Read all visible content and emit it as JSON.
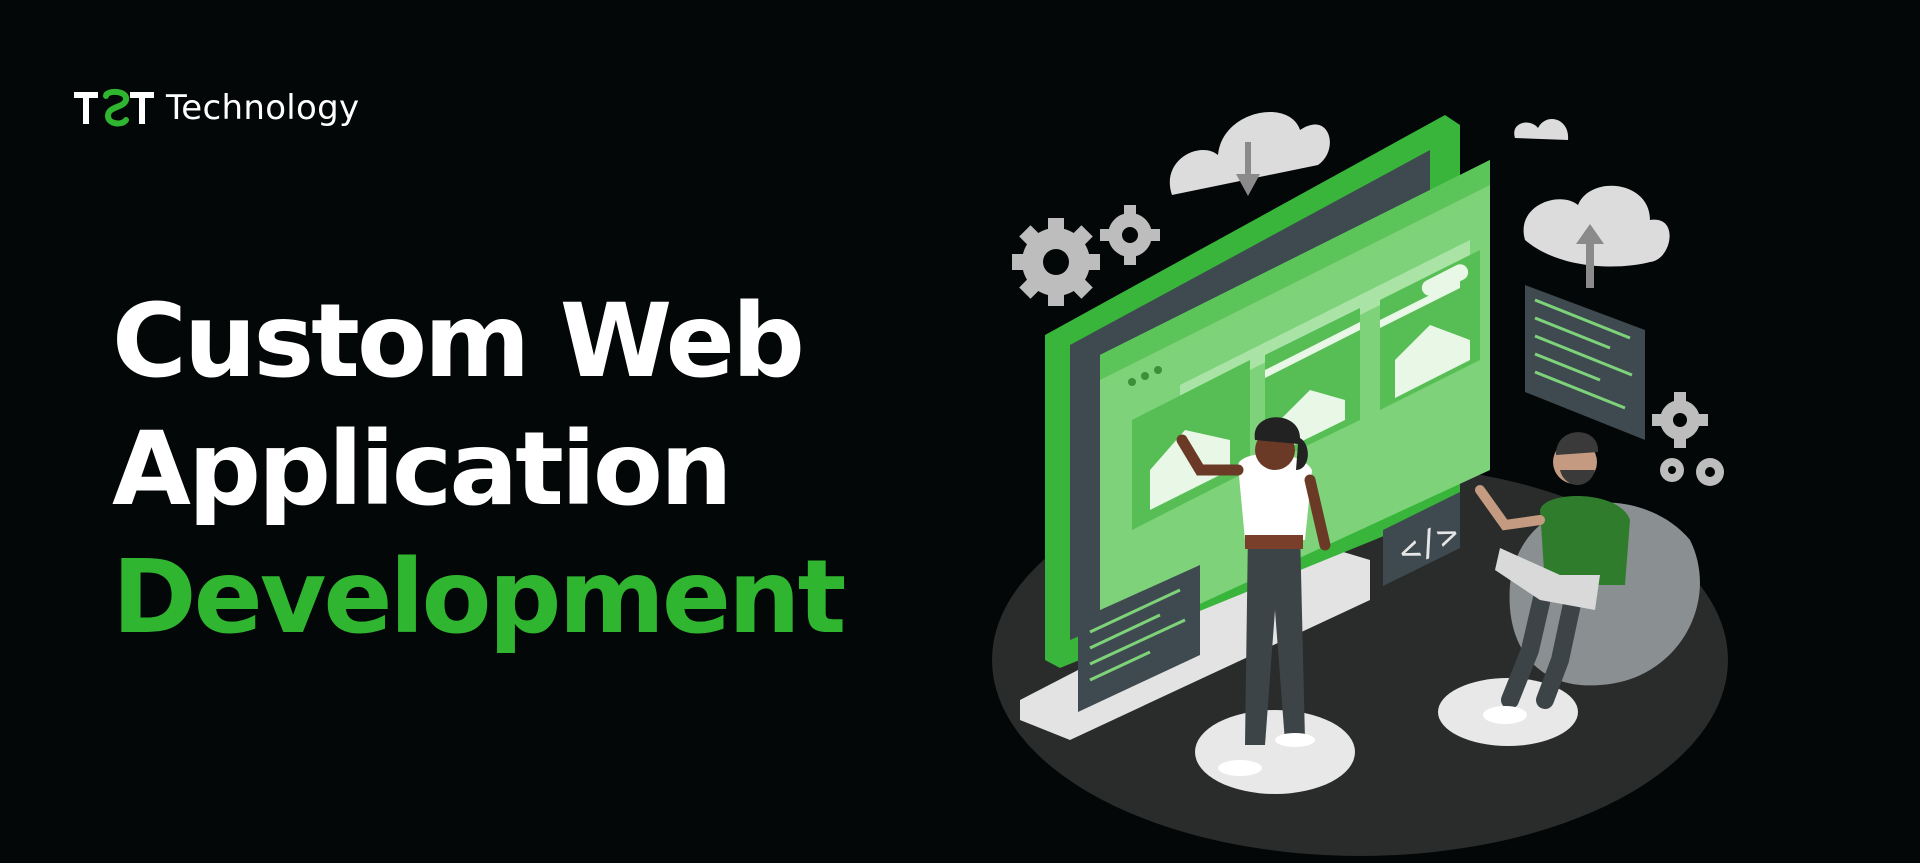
{
  "brand": {
    "logo_mark": "TST",
    "name": "Technology"
  },
  "headline": {
    "line1": "Custom Web",
    "line2": "Application",
    "line3": "Development"
  },
  "illustration": {
    "code_badge": "</>"
  },
  "colors": {
    "background": "#040707",
    "accent_green": "#2fb52f",
    "text_white": "#ffffff"
  }
}
